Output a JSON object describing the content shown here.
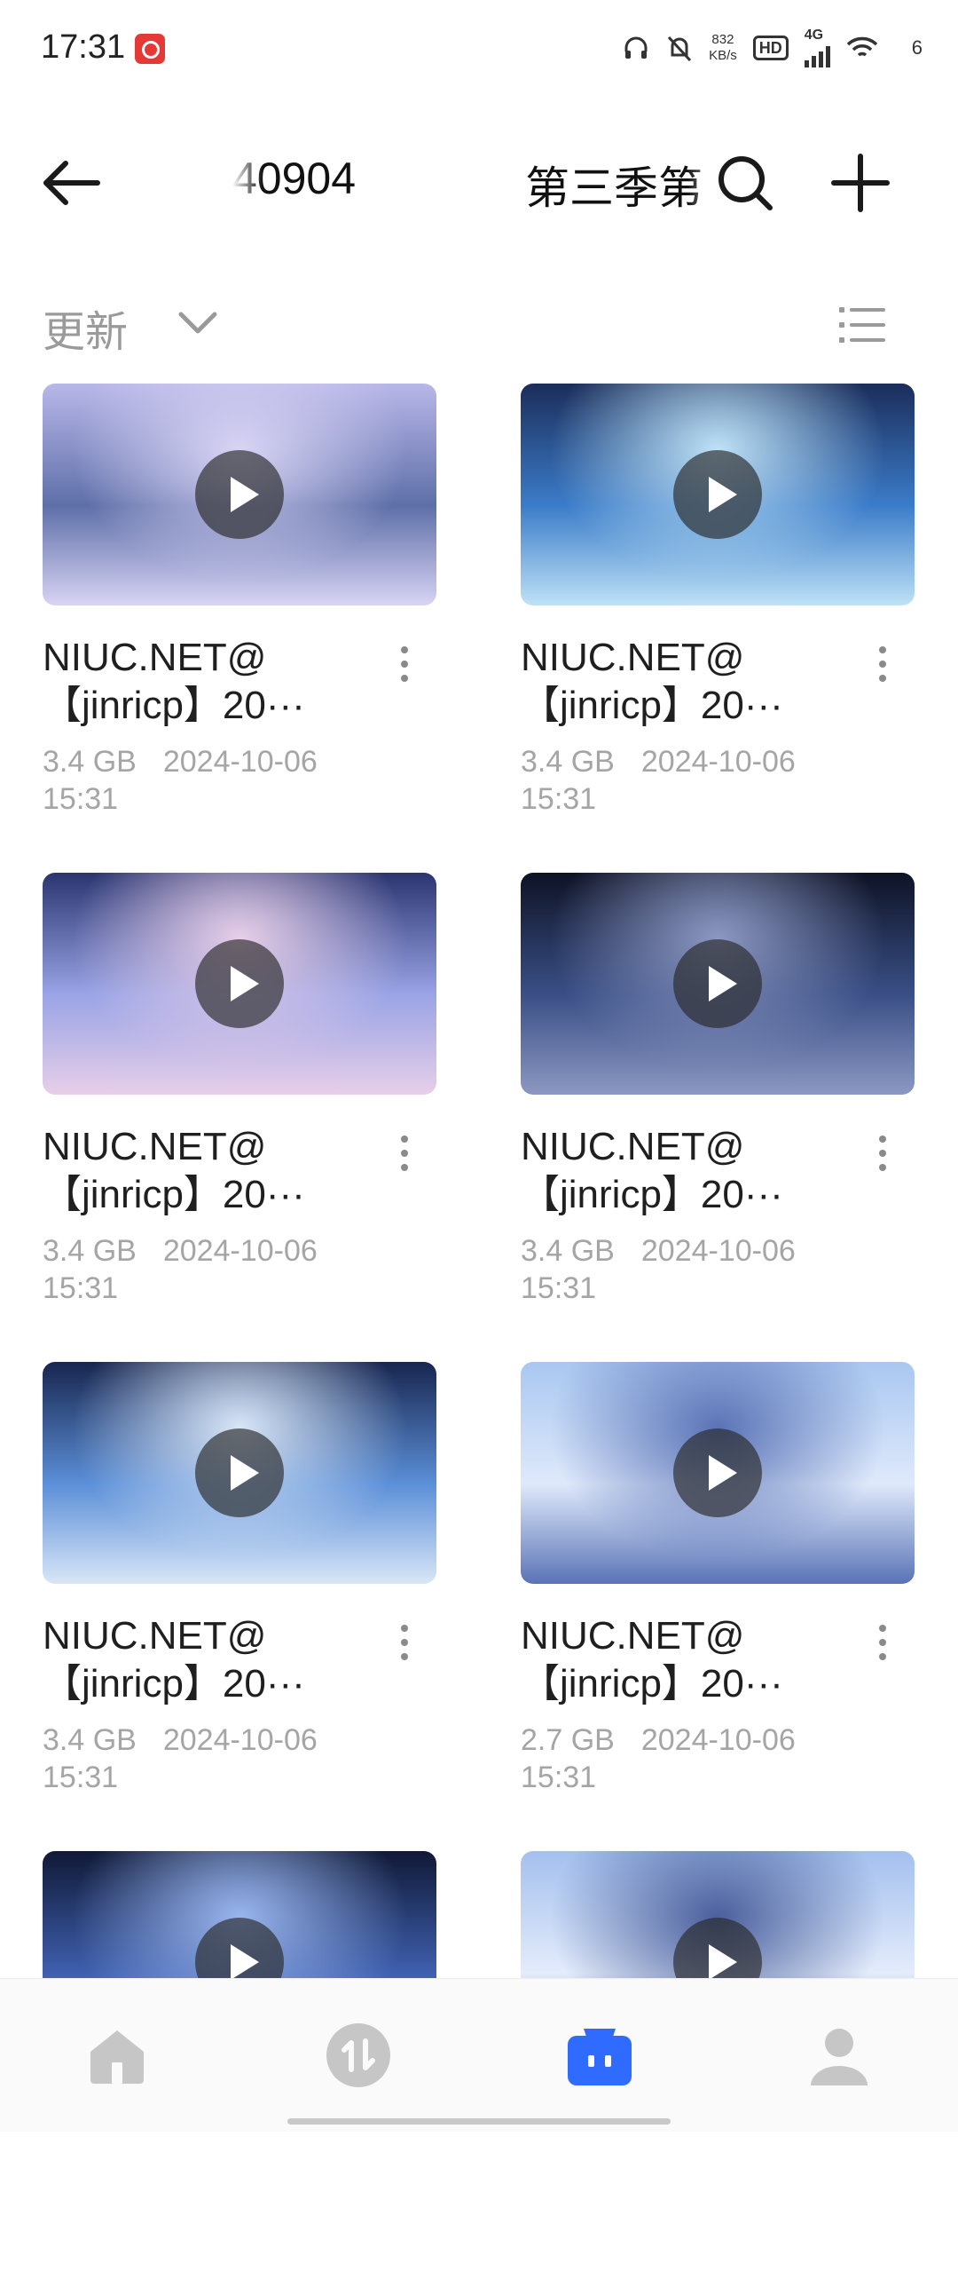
{
  "status_bar": {
    "time": "17:31",
    "speed_value": "832",
    "speed_unit": "KB/s",
    "hd": "HD",
    "network": "4G",
    "battery": "6"
  },
  "header": {
    "title_left": "40904",
    "title_right": "第三季第"
  },
  "sort": {
    "label": "更新"
  },
  "files": [
    {
      "name_line1": "NIUC.NET@",
      "name_line2": "【jinricp】20···",
      "size": "3.4 GB",
      "date": "2024-10-06",
      "time": "15:31",
      "thumb_colors": [
        "#b9b7e9",
        "#5e6fa8",
        "#d8d4f4"
      ]
    },
    {
      "name_line1": "NIUC.NET@",
      "name_line2": "【jinricp】20···",
      "size": "3.4 GB",
      "date": "2024-10-06",
      "time": "15:31",
      "thumb_colors": [
        "#1b2d5a",
        "#3b7cc9",
        "#bfe2f6"
      ]
    },
    {
      "name_line1": "NIUC.NET@",
      "name_line2": "【jinricp】20···",
      "size": "3.4 GB",
      "date": "2024-10-06",
      "time": "15:31",
      "thumb_colors": [
        "#2a3570",
        "#9aa4e6",
        "#e7cfe8"
      ]
    },
    {
      "name_line1": "NIUC.NET@",
      "name_line2": "【jinricp】20···",
      "size": "3.4 GB",
      "date": "2024-10-06",
      "time": "15:31",
      "thumb_colors": [
        "#0e1224",
        "#3a4f86",
        "#8c98c2"
      ]
    },
    {
      "name_line1": "NIUC.NET@",
      "name_line2": "【jinricp】20···",
      "size": "3.4 GB",
      "date": "2024-10-06",
      "time": "15:31",
      "thumb_colors": [
        "#18264f",
        "#5b8fd8",
        "#d9e6f7"
      ]
    },
    {
      "name_line1": "NIUC.NET@",
      "name_line2": "【jinricp】20···",
      "size": "2.7 GB",
      "date": "2024-10-06",
      "time": "15:31",
      "thumb_colors": [
        "#a9c7f0",
        "#dfe9fb",
        "#5a73b6"
      ]
    },
    {
      "name_line1": "",
      "name_line2": "",
      "size": "",
      "date": "",
      "time": "",
      "thumb_colors": [
        "#101936",
        "#3f5fae",
        "#9ab6ee"
      ]
    },
    {
      "name_line1": "",
      "name_line2": "",
      "size": "",
      "date": "",
      "time": "",
      "thumb_colors": [
        "#a4c0ee",
        "#e4ecfb",
        "#4a5f9c"
      ]
    }
  ],
  "nav": {
    "items": [
      "home-icon",
      "transfer-icon",
      "files-icon",
      "profile-icon"
    ],
    "active_color": "#2f6bff",
    "inactive_color": "#c6c6c6"
  }
}
